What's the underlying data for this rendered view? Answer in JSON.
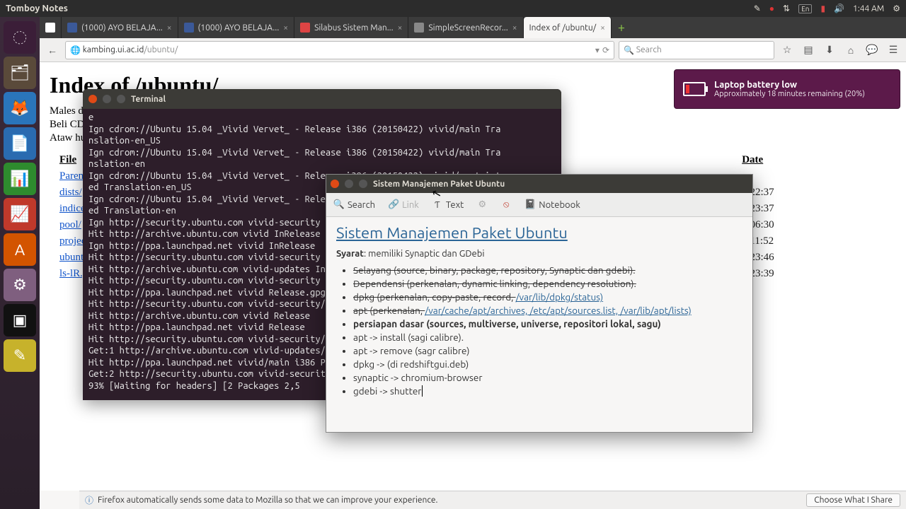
{
  "panel": {
    "app": "Tomboy Notes",
    "lang": "En",
    "time": "1:44 AM"
  },
  "tabs": [
    {
      "label": "",
      "favicon": "blank"
    },
    {
      "label": "(1000) AYO BELAJA..."
    },
    {
      "label": "(1000) AYO BELAJA..."
    },
    {
      "label": "Silabus Sistem Man..."
    },
    {
      "label": "SimpleScreenRecor..."
    },
    {
      "label": "Index of /ubuntu/",
      "active": true
    }
  ],
  "newtab": "+",
  "url": {
    "host": "kambing.ui.ac.id",
    "path": "/ubuntu/"
  },
  "search": {
    "placeholder": "Search"
  },
  "page": {
    "title": "Index of /ubuntu/",
    "desc": [
      "Males download? Bandwidth terbatas?",
      "Beli CD/DVD nya aja di JualLinux.com!",
      "Ataw hubungi Juragan di sini."
    ],
    "cols": {
      "file": "File",
      "date": "Date"
    },
    "rows": [
      {
        "name": "Parent directory",
        "date": ""
      },
      {
        "name": "dists/",
        "date": "5 22:37"
      },
      {
        "name": "indices/",
        "date": "5 23:37"
      },
      {
        "name": "pool/",
        "date": "0 06:30"
      },
      {
        "name": "project/",
        "date": "3 11:52"
      },
      {
        "name": "ubuntu/",
        "date": "5 23:46"
      },
      {
        "name": "ls-lR.gz",
        "date": "5 23:39"
      }
    ]
  },
  "notif": {
    "icon": "battery-low",
    "title": "Laptop battery low",
    "desc": "Approximately 18 minutes remaining (20%)"
  },
  "terminal": {
    "title": "Terminal",
    "lines": "e\nIgn cdrom://Ubuntu 15.04 _Vivid Vervet_ - Release i386 (20150422) vivid/main Tra\nnslation-en_US\nIgn cdrom://Ubuntu 15.04 _Vivid Vervet_ - Release i386 (20150422) vivid/main Tra\nnslation-en\nIgn cdrom://Ubuntu 15.04 _Vivid Vervet_ - Release i386 (20150422) vivid/restrict\ned Translation-en_US\nIgn cdrom://Ubuntu 15.04 _Vivid Vervet_ - Release i386 (20150422) vivid/restrict\ned Translation-en\nIgn http://security.ubuntu.com vivid-security InRelease\nHit http://archive.ubuntu.com vivid InRelease\nIgn http://ppa.launchpad.net vivid InRelease\nHit http://security.ubuntu.com vivid-security Release.gpg\nHit http://archive.ubuntu.com vivid-updates InRelease\nHit http://security.ubuntu.com vivid-security Release\nHit http://ppa.launchpad.net vivid Release.gpg\nHit http://security.ubuntu.com vivid-security/main Sources\nHit http://archive.ubuntu.com vivid Release\nHit http://ppa.launchpad.net vivid Release\nHit http://security.ubuntu.com vivid-security/restricted Sources\nGet:1 http://archive.ubuntu.com vivid-updates/main Sources [59.1 kB]\nHit http://ppa.launchpad.net vivid/main i386 Packages\nGet:2 http://security.ubuntu.com vivid-security/universe Sources [10.5 kB]\n93% [Waiting for headers] [2 Packages 2,5"
  },
  "tomboy": {
    "title": "Sistem Manajemen Paket Ubuntu",
    "toolbar": {
      "search": "Search",
      "link": "Link",
      "text": "Text",
      "tools": "Tools",
      "delete": "Delete",
      "notebook": "Notebook"
    },
    "heading": "Sistem Manajemen Paket Ubuntu",
    "syarat_label": "Syarat",
    "syarat_text": ": memiliki Synaptic dan GDebi",
    "items": {
      "i1a": "Selayang (source, binary, package, repository, Synaptic dan gdebi).",
      "i2a": "Dependensi (perkenalan, dynamic linking, dependency resolution).",
      "i3a": "dpkg (perkenalan, copy-paste, record, ",
      "i3b": "/var/lib/dpkg/status)",
      "i4a": "apt (perkenalan, ",
      "i4b": "/var/cache/apt/archives, /etc/apt/sources.list, /var/lib/apt/lists)",
      "i5a": "persiapan dasar (sources, multiverse, universe, repositori lokal, sagu)",
      "i6a": "apt -> install (sagi calibre).",
      "i7a": "apt -> remove (sagr calibre)",
      "i8a": "dpkg -> (di redshiftgui.deb)",
      "i9a": "synaptic -> chromium-browser",
      "i10a": "gdebi -> shutter"
    }
  },
  "infobar": {
    "text": "Firefox automatically sends some data to Mozilla so that we can improve your experience.",
    "choose": "Choose What I Share"
  }
}
